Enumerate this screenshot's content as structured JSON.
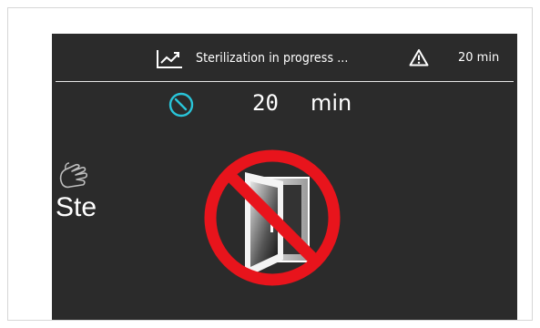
{
  "header": {
    "status_text": "Sterilization in progress ...",
    "time_text": "20 min",
    "trend_icon": "trend-chart-icon",
    "warning_icon": "warning-icon"
  },
  "timer": {
    "value": "20",
    "unit": "min",
    "icon": "clock-icon",
    "accent_color": "#29c4d8"
  },
  "side": {
    "label": "Ste",
    "icon": "hand-icon"
  },
  "graphic": {
    "icon": "no-door-open-icon",
    "prohibition_color": "#e8141c"
  },
  "colors": {
    "screen_background": "#2b2b2b",
    "text": "#ffffff"
  }
}
